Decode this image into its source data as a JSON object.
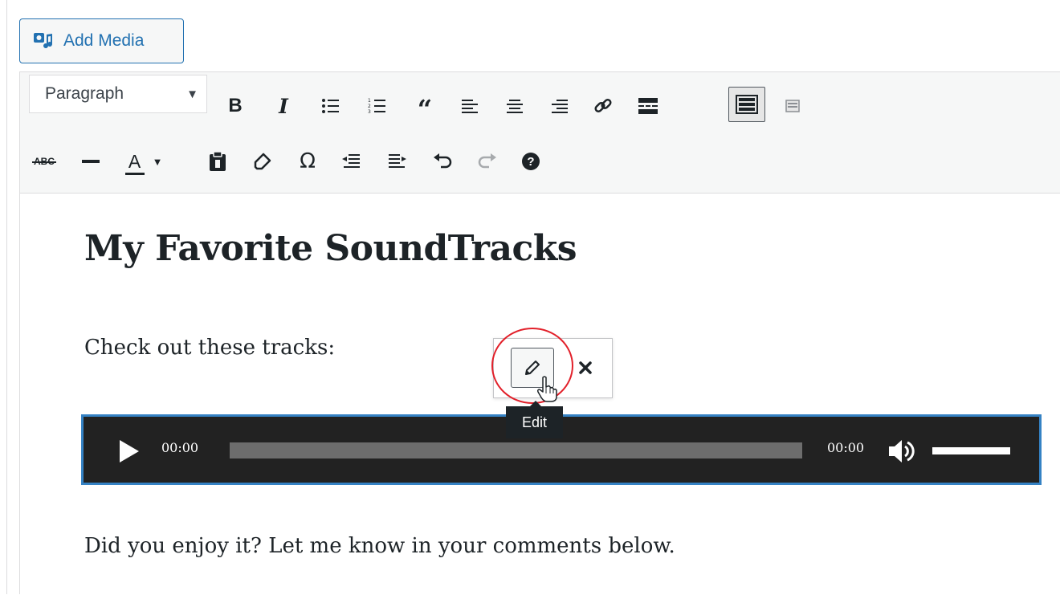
{
  "media": {
    "add_media_label": "Add Media"
  },
  "toolbar": {
    "format_selected": "Paragraph",
    "row1_icons": [
      "bold-icon",
      "italic-icon",
      "bullet-list-icon",
      "numbered-list-icon",
      "blockquote-icon",
      "align-left-icon",
      "align-center-icon",
      "align-right-icon",
      "link-icon",
      "read-more-icon",
      "toolbar-toggle-icon",
      "distraction-free-icon"
    ],
    "row2_icons": [
      "strikethrough-icon",
      "horizontal-line-icon",
      "text-color-icon",
      "paste-text-icon",
      "clear-formatting-icon",
      "special-character-icon",
      "outdent-icon",
      "indent-icon",
      "undo-icon",
      "redo-icon",
      "help-icon"
    ],
    "strike_label": "ABC",
    "text_color_letter": "A",
    "omega": "Ω",
    "help_symbol": "?"
  },
  "content": {
    "title": "My Favorite SoundTracks",
    "intro": "Check out these tracks:",
    "outro": "Did you enjoy it? Let me know in your comments below."
  },
  "audio": {
    "current_time": "00:00",
    "total_time": "00:00",
    "progress": 0,
    "volume": 1.0
  },
  "media_toolbar": {
    "tooltip": "Edit"
  },
  "colors": {
    "accent": "#2271b1",
    "selection": "#3582c4",
    "highlight": "#e2202a",
    "player_bg": "#222222"
  }
}
